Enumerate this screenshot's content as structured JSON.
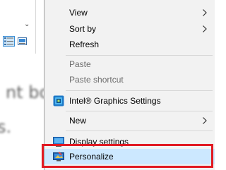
{
  "background": {
    "text_line_1": "nt bo",
    "text_line_2": "s."
  },
  "menu": {
    "items": [
      {
        "label": "View"
      },
      {
        "label": "Sort by"
      },
      {
        "label": "Refresh"
      },
      {
        "label": "Paste"
      },
      {
        "label": "Paste shortcut"
      },
      {
        "label": "Intel® Graphics Settings"
      },
      {
        "label": "New"
      },
      {
        "label": "Display settings"
      },
      {
        "label": "Personalize"
      }
    ]
  },
  "colors": {
    "menu_background": "#f2f2f2",
    "hover_background": "#cce8ff",
    "highlight_border": "#e11a22",
    "disabled_text": "#6d6d6d"
  },
  "icons": {
    "intel_graphics": "intel-graphics-icon",
    "display_settings": "display-settings-icon",
    "personalize": "personalize-icon"
  }
}
